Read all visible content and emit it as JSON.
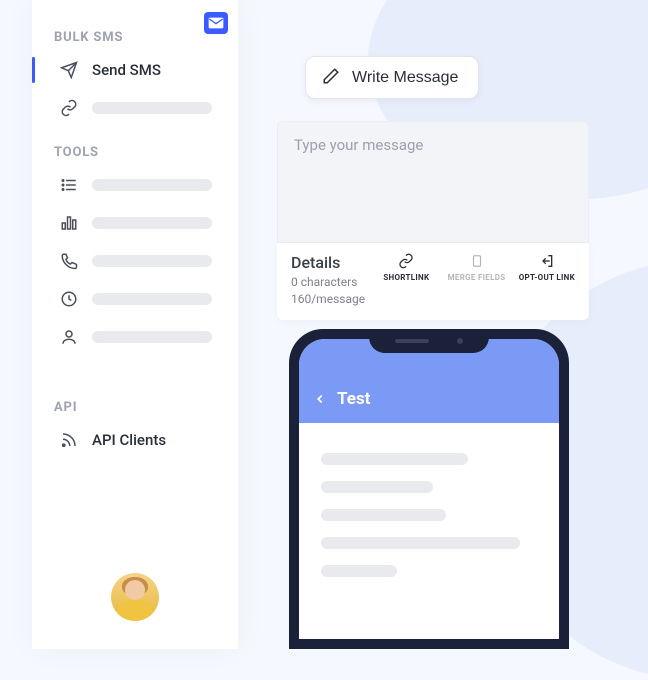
{
  "sidebar": {
    "section_bulk": "BULK SMS",
    "section_tools": "TOOLS",
    "section_api": "API",
    "send_sms_label": "Send SMS",
    "api_clients_label": "API Clients"
  },
  "compose": {
    "write_button": "Write Message",
    "placeholder": "Type your message"
  },
  "details": {
    "title": "Details",
    "char_count": "0 characters",
    "per_msg": "160/message",
    "shortlink": "SHORTLINK",
    "merge_fields": "MERGE FIELDS",
    "optout": "OPT-OUT LINK"
  },
  "phone": {
    "title": "Test"
  }
}
